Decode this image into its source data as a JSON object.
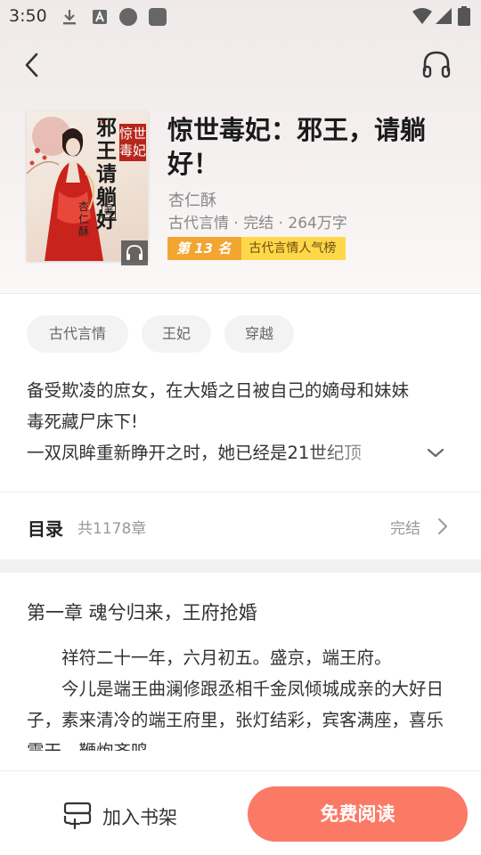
{
  "status_bar": {
    "time": "3:50",
    "icons": [
      "download-icon",
      "a-icon",
      "circle-icon",
      "square-icon",
      "wifi-icon",
      "signal-icon",
      "battery-icon"
    ]
  },
  "nav": {
    "back_icon": "back-icon",
    "audio_icon": "headphones-icon"
  },
  "book": {
    "title": "惊世毒妃：邪王，请躺好！",
    "author": "杏仁酥",
    "meta": "古代言情 · 完结 · 264万字",
    "rank_number": "第 13 名",
    "rank_list": "古代言情人气榜",
    "cover": {
      "title_text": "邪王请躺好",
      "subtitle_text": "惊世毒妃",
      "author_text": "杏仁酥",
      "author_suffix": "著"
    }
  },
  "tags": [
    "古代言情",
    "王妃",
    "穿越"
  ],
  "intro": {
    "line1": "备受欺凌的庶女，在大婚之日被自己的嫡母和妹妹",
    "line2": "毒死藏尸床下!",
    "line3": "一双凤眸重新睁开之时，她已经是21世纪顶"
  },
  "toc": {
    "label": "目录",
    "count": "共1178章",
    "status": "完结"
  },
  "chapter": {
    "title": "第一章 魂兮归来，王府抢婚",
    "paragraphs": [
      "祥符二十一年，六月初五。盛京，端王府。",
      "今儿是端王曲澜修跟丞相千金凤倾城成亲的大好日子，素来清冷的端王府里，张灯结彩，宾客满座，喜乐震天，鞭炮齐鸣。"
    ]
  },
  "bottom": {
    "shelf_label": "加入书架",
    "read_label": "免费阅读"
  },
  "colors": {
    "accent": "#fb7a66",
    "rank_orange": "#f2a531",
    "rank_yellow": "#ffd84a"
  }
}
